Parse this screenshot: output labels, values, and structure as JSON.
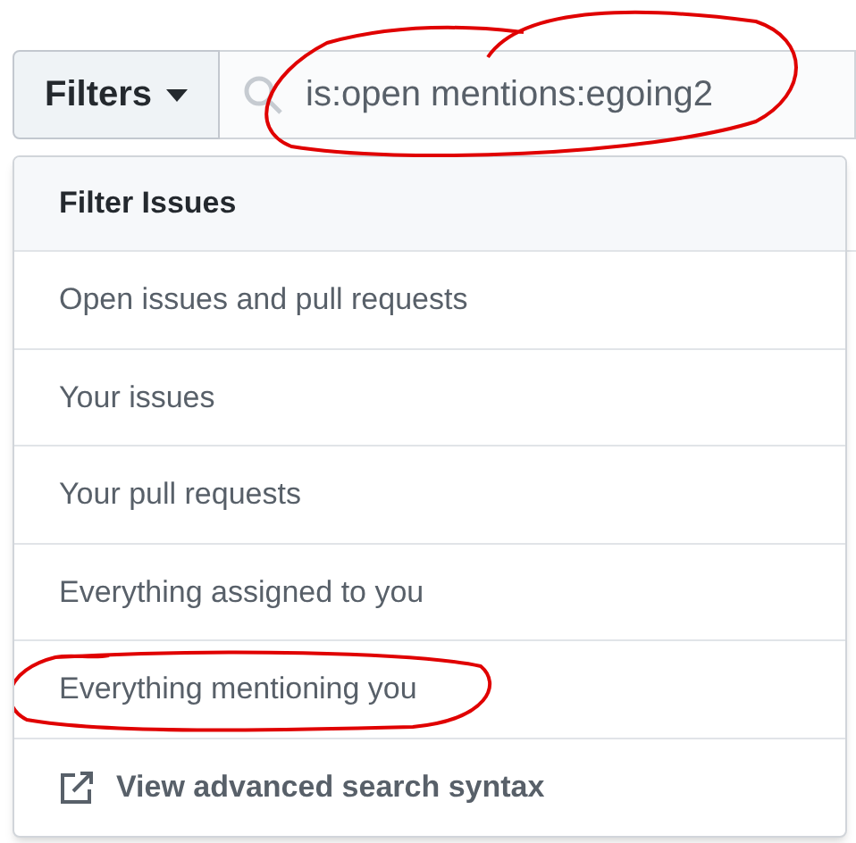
{
  "filters_button": {
    "label": "Filters"
  },
  "search": {
    "value": "is:open mentions:egoing2"
  },
  "menu": {
    "title": "Filter Issues",
    "items": [
      {
        "label": "Open issues and pull requests",
        "annotated": false
      },
      {
        "label": "Your issues",
        "annotated": false
      },
      {
        "label": "Your pull requests",
        "annotated": false
      },
      {
        "label": "Everything assigned to you",
        "annotated": false
      },
      {
        "label": "Everything mentioning you",
        "annotated": true
      }
    ],
    "footer_link": "View advanced search syntax"
  }
}
